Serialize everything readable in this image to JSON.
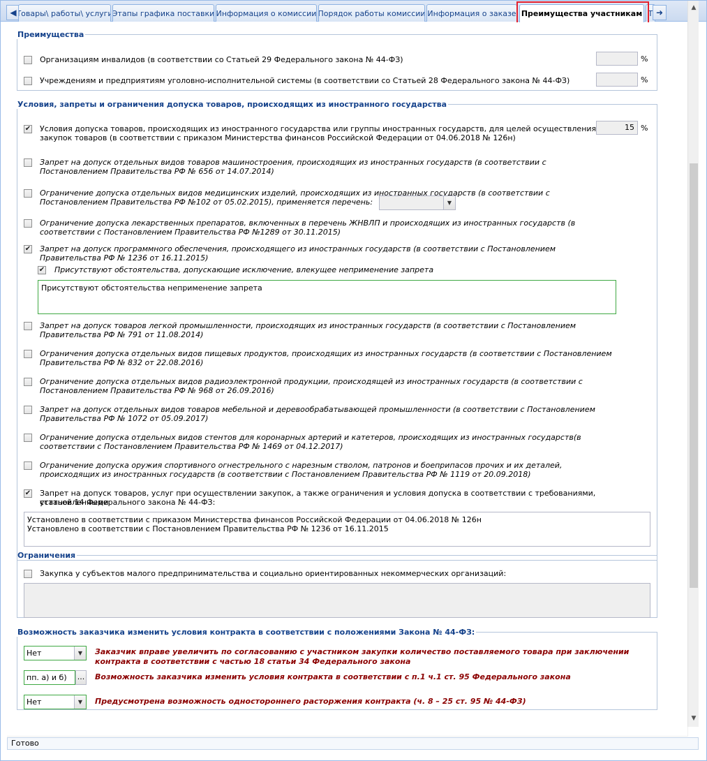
{
  "tabs": [
    {
      "label": "Товары\\ работы\\ услуги"
    },
    {
      "label": "Этапы графика поставки"
    },
    {
      "label": "Информация о комиссии"
    },
    {
      "label": "Порядок работы комиссии"
    },
    {
      "label": "Информация о заказе"
    },
    {
      "label": "Преимущества участникам"
    },
    {
      "label": "Т"
    }
  ],
  "advantages": {
    "legend": "Преимущества",
    "items": [
      {
        "label": "Организациям инвалидов (в соответствии со Статьей 29 Федерального закона № 44-ФЗ)",
        "value": "",
        "unit": "%"
      },
      {
        "label": "Учреждениям и предприятиям уголовно-исполнительной системы (в соответствии со Статьей 28 Федерального закона № 44-ФЗ)",
        "value": "",
        "unit": "%"
      }
    ]
  },
  "conditions": {
    "legend": "Условия, запреты и ограничения допуска товаров, происходящих из иностранного государства",
    "item0": {
      "line1": "Условия допуска товаров, происходящих из иностранного государства или группы иностранных государств, для целей осуществления",
      "line2": "закупок товаров (в соответствии с приказом Министерства финансов Российской Федерации от 04.06.2018 № 126н)",
      "value": "15",
      "unit": "%"
    },
    "item1": {
      "line1": "Запрет на допуск отдельных видов товаров машиностроения, происходящих из иностранных государств (в соответствии с",
      "line2": "Постановлением Правительства РФ № 656 от 14.07.2014)"
    },
    "item2": {
      "line1": "Ограничение допуска отдельных видов медицинских изделий, происходящих из иностранных государств (в соответствии с",
      "line2": "Постановлением Правительства РФ №102 от 05.02.2015), применяется перечень:",
      "select": ""
    },
    "item3": {
      "line1": "Ограничение допуска лекарственных препаратов, включенных в перечень ЖНВЛП и происходящих из иностранных государств (в",
      "line2": "соответствии с Постановлением Правительства РФ №1289 от 30.11.2015)"
    },
    "item4": {
      "line1": "Запрет на допуск программного обеспечения, происходящего из иностранных государств (в соответствии с Постановлением",
      "line2": "Правительства РФ № 1236 от 16.11.2015)",
      "sub_label": "Присутствуют обстоятельства, допускающие исключение, влекущее неприменение запрета",
      "sub_text": "Присутствуют обстоятельства неприменение запрета"
    },
    "item5": {
      "line1": "Запрет на допуск товаров легкой промышленности, происходящих из иностранных государств (в соответствии с Постановлением",
      "line2": "Правительства РФ № 791 от 11.08.2014)"
    },
    "item6": {
      "line1": "Ограничения допуска отдельных видов пищевых продуктов, происходящих из иностранных государств (в соответствии с Постановлением",
      "line2": "Правительства РФ № 832 от 22.08.2016)"
    },
    "item7": {
      "line1": "Ограничение допуска отдельных видов радиоэлектронной продукции, происходящей из иностранных государств (в соответствии с",
      "line2": "Постановлением Правительства РФ № 968 от 26.09.2016)"
    },
    "item8": {
      "line1": "Запрет на допуск отдельных видов товаров мебельной и деревообрабатывающей промышленности (в соответствии с Постановлением",
      "line2": "Правительства РФ № 1072 от 05.09.2017)"
    },
    "item9": {
      "line1": "Ограничение допуска отдельных видов стентов для коронарных артерий и катетеров, происходящих из иностранных государств(в",
      "line2": "соответствии с Постановлением Правительства РФ № 1469 от 04.12.2017)"
    },
    "item10": {
      "line1": "Ограничение допуска оружия спортивного огнестрельного с нарезным стволом, патронов и боеприпасов прочих и их деталей,",
      "line2": "происходящих из иностранных государств (в соответствии с Постановлением Правительства РФ № 1119 от 20.09.2018)"
    },
    "item11": {
      "line1": "Запрет на допуск товаров, услуг при осуществлении закупок, а также ограничения и условия допуска в соответствии с требованиями, установленными",
      "line2": "статьей 14 Федерального закона № 44-ФЗ:",
      "text1": "Установлено в соответствии с приказом Министерства финансов Российской Федерации от 04.06.2018 № 126н",
      "text2": "Установлено в соответствии с Постановлением Правительства РФ № 1236 от 16.11.2015"
    }
  },
  "restrictions": {
    "legend": "Ограничения",
    "label": "Закупка у субъектов малого предпринимательства и социально ориентированных некоммерческих организаций:"
  },
  "contract_change": {
    "legend": "Возможность заказчика изменить условия контракта в соответствии с положениями Закона № 44-ФЗ:",
    "row1": {
      "value": "Нет",
      "line1": "Заказчик вправе увеличить по согласованию с участником закупки количество поставляемого товара при заключении",
      "line2": "контракта в соответствии с частью 18 статьи 34 Федерального закона"
    },
    "row2": {
      "value": "пп. а) и б)",
      "dots": "...",
      "text": "Возможность заказчика изменить условия контракта в соответствии с п.1 ч.1 ст. 95 Федерального закона"
    },
    "row3": {
      "value": "Нет",
      "text": "Предусмотрена возможность одностороннего расторжения контракта (ч. 8 – 25 ст. 95 № 44-ФЗ)"
    }
  },
  "status": "Готово"
}
